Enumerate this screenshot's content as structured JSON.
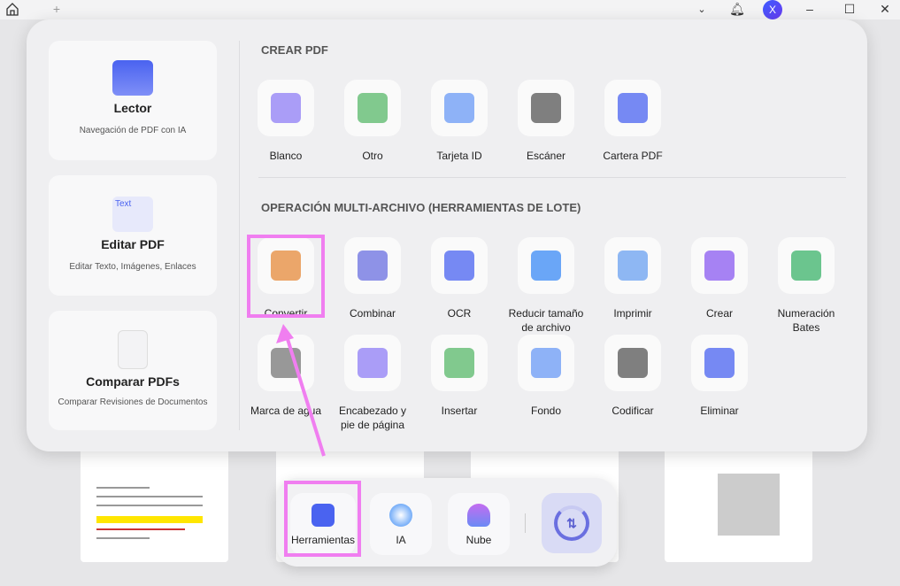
{
  "titlebar": {
    "add_tab": "+",
    "avatar_letter": "X"
  },
  "left_cards": [
    {
      "title": "Lector",
      "subtitle": "Navegación de PDF con IA"
    },
    {
      "title": "Editar PDF",
      "subtitle": "Editar Texto, Imágenes, Enlaces",
      "icon_text": "Text"
    },
    {
      "title": "Comparar PDFs",
      "subtitle": "Comparar Revisiones de Documentos"
    }
  ],
  "create_section": {
    "title": "CREAR PDF",
    "items": [
      "Blanco",
      "Otro",
      "Tarjeta ID",
      "Escáner",
      "Cartera PDF"
    ]
  },
  "batch_section": {
    "title": "OPERACIÓN MULTI-ARCHIVO (HERRAMIENTAS DE LOTE)",
    "items": [
      "Convertir",
      "Combinar",
      "OCR",
      "Reducir tamaño de archivo",
      "Imprimir",
      "Crear",
      "Numeración Bates",
      "Marca de agua",
      "Encabezado y pie de página",
      "Insertar",
      "Fondo",
      "Codificar",
      "Eliminar"
    ]
  },
  "dock": {
    "items": [
      "Herramientas",
      "IA",
      "Nube"
    ]
  },
  "colors": {
    "highlight": "#f07ef0",
    "accent": "#4a63f0"
  }
}
